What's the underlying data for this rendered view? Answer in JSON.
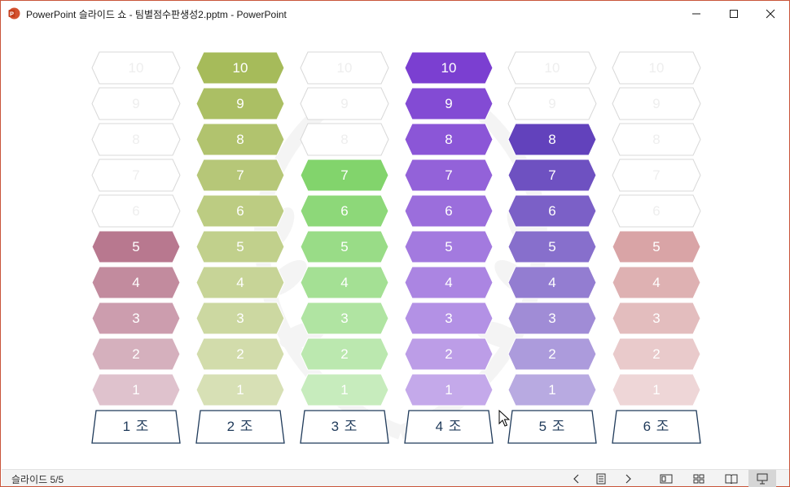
{
  "window": {
    "title": "PowerPoint 슬라이드 쇼  -  팀별점수판생성2.pptm - PowerPoint",
    "app_icon": "powerpoint-icon",
    "frame_color": "#c9553a"
  },
  "slide": {
    "off_color": "#ffffff",
    "off_border": "#d8d8d8",
    "teams": [
      {
        "label": "1 조",
        "score": 5,
        "color": "#b8788f",
        "levels": [
          "10",
          "9",
          "8",
          "7",
          "6",
          "5",
          "4",
          "3",
          "2",
          "1"
        ]
      },
      {
        "label": "2 조",
        "score": 10,
        "color": "#a6bb5a",
        "levels": [
          "10",
          "9",
          "8",
          "7",
          "6",
          "5",
          "4",
          "3",
          "2",
          "1"
        ]
      },
      {
        "label": "3 조",
        "score": 7,
        "color": "#82d46c",
        "levels": [
          "10",
          "9",
          "8",
          "7",
          "6",
          "5",
          "4",
          "3",
          "2",
          "1"
        ]
      },
      {
        "label": "4 조",
        "score": 10,
        "color": "#7b3fd1",
        "levels": [
          "10",
          "9",
          "8",
          "7",
          "6",
          "5",
          "4",
          "3",
          "2",
          "1"
        ]
      },
      {
        "label": "5 조",
        "score": 8,
        "color": "#6242bc",
        "levels": [
          "10",
          "9",
          "8",
          "7",
          "6",
          "5",
          "4",
          "3",
          "2",
          "1"
        ]
      },
      {
        "label": "6 조",
        "score": 5,
        "color": "#d9a4a6",
        "levels": [
          "10",
          "9",
          "8",
          "7",
          "6",
          "5",
          "4",
          "3",
          "2",
          "1"
        ]
      }
    ]
  },
  "statusbar": {
    "slide_count": "슬라이드 5/5",
    "buttons": [
      "prev-slide-icon",
      "slide-list-icon",
      "next-slide-icon",
      "normal-view-icon",
      "slide-sorter-icon",
      "reading-view-icon",
      "slideshow-icon"
    ],
    "active_button": "slideshow-icon"
  }
}
